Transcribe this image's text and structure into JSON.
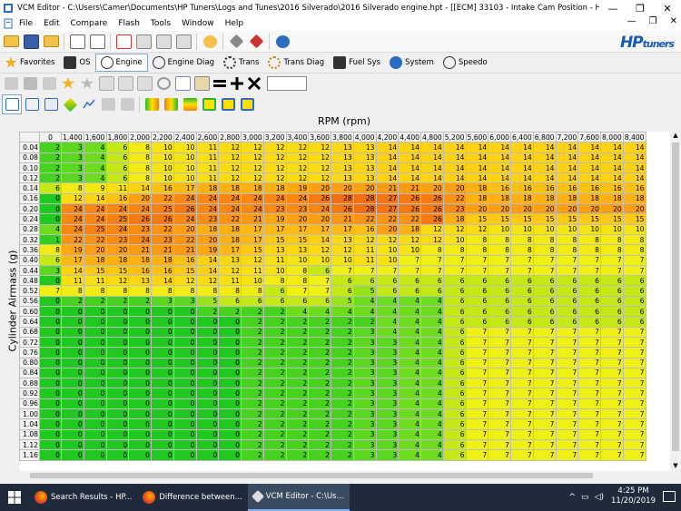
{
  "window": {
    "title": "VCM Editor - C:\\Users\\Camer\\Documents\\HP Tuners\\Logs and Tunes\\2016 Silverado\\2016 Silverado engine.hpt - [[ECM] 33103 - Intake Cam Position - High Baro]",
    "minimize": "—",
    "maximize": "❐",
    "close": "✕"
  },
  "menu": [
    "File",
    "Edit",
    "Compare",
    "Flash",
    "Tools",
    "Window",
    "Help"
  ],
  "mdi_controls": [
    "—",
    "❐",
    "✕"
  ],
  "logo": {
    "main": "HP",
    "sub": "tuners"
  },
  "nav_tabs": [
    {
      "label": "Favorites",
      "icon": "star-icon"
    },
    {
      "label": "OS",
      "icon": "chip-icon"
    },
    {
      "label": "Engine",
      "icon": "engine-icon",
      "active": true
    },
    {
      "label": "Engine Diag",
      "icon": "engine-diag-icon"
    },
    {
      "label": "Trans",
      "icon": "gear-icon"
    },
    {
      "label": "Trans Diag",
      "icon": "gear-diag-icon"
    },
    {
      "label": "Fuel Sys",
      "icon": "fuel-icon"
    },
    {
      "label": "System",
      "icon": "system-icon"
    },
    {
      "label": "Speedo",
      "icon": "speedo-icon"
    }
  ],
  "table": {
    "x_axis_label": "RPM (rpm)",
    "y_axis_label": "Cylinder Airmass (g)",
    "rpm": [
      "0",
      "1,400",
      "1,600",
      "1,800",
      "2,000",
      "2,200",
      "2,400",
      "2,600",
      "2,800",
      "3,000",
      "3,200",
      "3,400",
      "3,600",
      "3,800",
      "4,000",
      "4,200",
      "4,400",
      "4,800",
      "5,200",
      "5,600",
      "6,000",
      "6,400",
      "6,800",
      "7,200",
      "7,600",
      "8,000",
      "8,400"
    ],
    "airmass": [
      "0.04",
      "0.08",
      "0.10",
      "0.12",
      "0.14",
      "0.16",
      "0.20",
      "0.24",
      "0.28",
      "0.32",
      "0.36",
      "0.40",
      "0.44",
      "0.48",
      "0.52",
      "0.56",
      "0.60",
      "0.64",
      "0.68",
      "0.72",
      "0.76",
      "0.80",
      "0.84",
      "0.88",
      "0.92",
      "0.96",
      "1.00",
      "1.04",
      "1.08",
      "1.12",
      "1.16"
    ],
    "values": [
      [
        2,
        3,
        4,
        6,
        8,
        10,
        10,
        11,
        12,
        12,
        12,
        12,
        12,
        13,
        13,
        14,
        14,
        14,
        14,
        14,
        14,
        14,
        14,
        14,
        14,
        14,
        14
      ],
      [
        2,
        3,
        4,
        6,
        8,
        10,
        10,
        11,
        12,
        12,
        12,
        12,
        12,
        13,
        13,
        14,
        14,
        14,
        14,
        14,
        14,
        14,
        14,
        14,
        14,
        14,
        14
      ],
      [
        2,
        3,
        4,
        6,
        8,
        10,
        10,
        11,
        12,
        12,
        12,
        12,
        12,
        13,
        13,
        14,
        14,
        14,
        14,
        14,
        14,
        14,
        14,
        14,
        14,
        14,
        14
      ],
      [
        2,
        3,
        4,
        6,
        8,
        10,
        10,
        11,
        12,
        12,
        12,
        12,
        12,
        13,
        13,
        14,
        14,
        14,
        14,
        14,
        14,
        14,
        14,
        14,
        14,
        14,
        14
      ],
      [
        6,
        8,
        9,
        11,
        14,
        16,
        17,
        18,
        18,
        18,
        18,
        19,
        20,
        20,
        20,
        21,
        21,
        20,
        20,
        18,
        16,
        16,
        16,
        16,
        16,
        16,
        16
      ],
      [
        0,
        12,
        14,
        16,
        20,
        22,
        24,
        24,
        24,
        24,
        24,
        24,
        26,
        28,
        28,
        27,
        26,
        26,
        22,
        18,
        18,
        18,
        18,
        18,
        18,
        18,
        18
      ],
      [
        0,
        24,
        24,
        24,
        24,
        25,
        26,
        24,
        24,
        24,
        23,
        23,
        24,
        26,
        28,
        27,
        26,
        26,
        23,
        20,
        20,
        20,
        20,
        20,
        20,
        20,
        20
      ],
      [
        0,
        24,
        24,
        25,
        26,
        26,
        24,
        23,
        22,
        21,
        19,
        20,
        20,
        21,
        22,
        22,
        22,
        26,
        18,
        15,
        15,
        15,
        15,
        15,
        15,
        15,
        15
      ],
      [
        4,
        24,
        25,
        24,
        23,
        22,
        20,
        18,
        18,
        17,
        17,
        17,
        17,
        17,
        16,
        20,
        18,
        12,
        12,
        12,
        10,
        10,
        10,
        10,
        10,
        10,
        10
      ],
      [
        1,
        22,
        22,
        23,
        24,
        23,
        22,
        20,
        18,
        17,
        15,
        15,
        14,
        13,
        12,
        12,
        12,
        12,
        10,
        8,
        8,
        8,
        8,
        8,
        8,
        8,
        8
      ],
      [
        8,
        19,
        20,
        20,
        21,
        21,
        21,
        19,
        17,
        15,
        13,
        13,
        12,
        12,
        11,
        10,
        10,
        8,
        8,
        8,
        8,
        8,
        8,
        8,
        8,
        8,
        8
      ],
      [
        6,
        17,
        18,
        18,
        18,
        18,
        16,
        14,
        13,
        12,
        11,
        10,
        10,
        10,
        11,
        10,
        7,
        7,
        7,
        7,
        7,
        7,
        7,
        7,
        7,
        7,
        7
      ],
      [
        3,
        14,
        15,
        15,
        16,
        16,
        15,
        14,
        12,
        11,
        10,
        8,
        6,
        7,
        7,
        7,
        7,
        7,
        7,
        7,
        7,
        7,
        7,
        7,
        7,
        7,
        7
      ],
      [
        0,
        11,
        11,
        12,
        13,
        14,
        12,
        12,
        11,
        10,
        8,
        8,
        7,
        6,
        6,
        6,
        6,
        6,
        6,
        6,
        6,
        6,
        6,
        6,
        6,
        6,
        6
      ],
      [
        7,
        8,
        8,
        8,
        8,
        8,
        8,
        8,
        8,
        8,
        6,
        7,
        7,
        6,
        5,
        6,
        6,
        6,
        6,
        6,
        6,
        6,
        6,
        6,
        6,
        6,
        6
      ],
      [
        0,
        2,
        2,
        2,
        2,
        3,
        3,
        5,
        6,
        6,
        6,
        6,
        6,
        5,
        4,
        4,
        4,
        4,
        6,
        6,
        6,
        6,
        6,
        6,
        6,
        6,
        6
      ],
      [
        0,
        0,
        0,
        0,
        0,
        0,
        0,
        2,
        2,
        2,
        2,
        4,
        4,
        4,
        4,
        4,
        4,
        4,
        6,
        6,
        6,
        6,
        6,
        6,
        6,
        6,
        6
      ],
      [
        0,
        0,
        0,
        0,
        0,
        0,
        0,
        0,
        0,
        2,
        2,
        2,
        2,
        2,
        2,
        4,
        4,
        4,
        6,
        6,
        6,
        6,
        6,
        6,
        6,
        6,
        6
      ],
      [
        0,
        0,
        0,
        0,
        0,
        0,
        0,
        0,
        0,
        2,
        2,
        2,
        2,
        2,
        3,
        4,
        4,
        4,
        6,
        7,
        7,
        7,
        7,
        7,
        7,
        7,
        7
      ],
      [
        0,
        0,
        0,
        0,
        0,
        0,
        0,
        0,
        0,
        2,
        2,
        2,
        2,
        2,
        3,
        3,
        4,
        4,
        6,
        7,
        7,
        7,
        7,
        7,
        7,
        7,
        7
      ],
      [
        0,
        0,
        0,
        0,
        0,
        0,
        0,
        0,
        0,
        2,
        2,
        2,
        2,
        2,
        3,
        3,
        4,
        4,
        6,
        7,
        7,
        7,
        7,
        7,
        7,
        7,
        7
      ],
      [
        0,
        0,
        0,
        0,
        0,
        0,
        0,
        0,
        0,
        2,
        2,
        2,
        2,
        2,
        3,
        3,
        4,
        4,
        6,
        7,
        7,
        7,
        7,
        7,
        7,
        7,
        7
      ],
      [
        0,
        0,
        0,
        0,
        0,
        0,
        0,
        0,
        0,
        2,
        2,
        2,
        2,
        2,
        3,
        3,
        4,
        4,
        6,
        7,
        7,
        7,
        7,
        7,
        7,
        7,
        7
      ],
      [
        0,
        0,
        0,
        0,
        0,
        0,
        0,
        0,
        0,
        2,
        2,
        2,
        2,
        2,
        3,
        3,
        4,
        4,
        6,
        7,
        7,
        7,
        7,
        7,
        7,
        7,
        7
      ],
      [
        0,
        0,
        0,
        0,
        0,
        0,
        0,
        0,
        0,
        2,
        2,
        2,
        2,
        2,
        3,
        3,
        4,
        4,
        6,
        7,
        7,
        7,
        7,
        7,
        7,
        7,
        7
      ],
      [
        0,
        0,
        0,
        0,
        0,
        0,
        0,
        0,
        0,
        2,
        2,
        2,
        2,
        2,
        3,
        3,
        4,
        4,
        6,
        7,
        7,
        7,
        7,
        7,
        7,
        7,
        7
      ],
      [
        0,
        0,
        0,
        0,
        0,
        0,
        0,
        0,
        0,
        2,
        2,
        2,
        2,
        2,
        3,
        3,
        4,
        4,
        6,
        7,
        7,
        7,
        7,
        7,
        7,
        7,
        7
      ],
      [
        0,
        0,
        0,
        0,
        0,
        0,
        0,
        0,
        0,
        2,
        2,
        2,
        2,
        2,
        3,
        3,
        4,
        4,
        6,
        7,
        7,
        7,
        7,
        7,
        7,
        7,
        7
      ],
      [
        0,
        0,
        0,
        0,
        0,
        0,
        0,
        0,
        0,
        2,
        2,
        2,
        2,
        2,
        3,
        3,
        4,
        4,
        6,
        7,
        7,
        7,
        7,
        7,
        7,
        7,
        7
      ],
      [
        0,
        0,
        0,
        0,
        0,
        0,
        0,
        0,
        0,
        2,
        2,
        2,
        2,
        2,
        3,
        3,
        4,
        4,
        6,
        7,
        7,
        7,
        7,
        7,
        7,
        7,
        7
      ],
      [
        0,
        0,
        0,
        0,
        0,
        0,
        0,
        0,
        0,
        2,
        2,
        2,
        2,
        2,
        3,
        3,
        4,
        4,
        6,
        7,
        7,
        7,
        7,
        7,
        7,
        7,
        7
      ]
    ]
  },
  "taskbar": {
    "start_icon": "windows-icon",
    "tasks": [
      {
        "label": "Search Results - HP...",
        "icon": "firefox-icon"
      },
      {
        "label": "Difference between...",
        "icon": "firefox-icon"
      },
      {
        "label": "VCM Editor - C:\\Us...",
        "icon": "vcm-icon",
        "active": true
      }
    ],
    "time": "4:25 PM",
    "date": "11/20/2019"
  }
}
